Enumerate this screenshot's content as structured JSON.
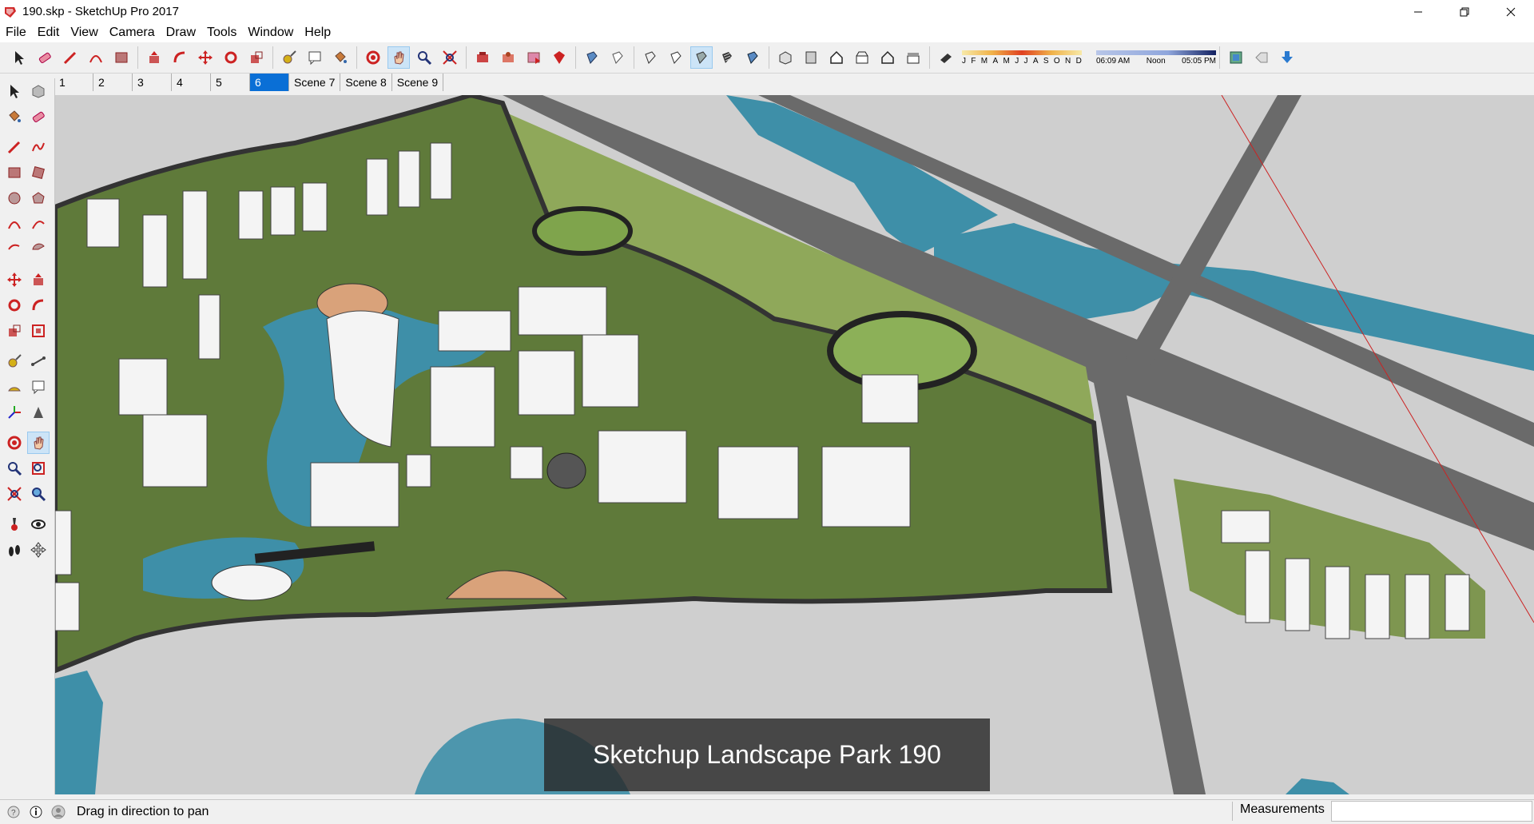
{
  "window": {
    "title": "190.skp - SketchUp Pro 2017",
    "app_icon": "sketchup-logo-icon",
    "controls": [
      "minimize-icon",
      "restore-icon",
      "close-icon"
    ]
  },
  "menu": [
    "File",
    "Edit",
    "View",
    "Camera",
    "Draw",
    "Tools",
    "Window",
    "Help"
  ],
  "toolbar": {
    "groups": [
      [
        "select-icon",
        "eraser-icon",
        "pencil-icon",
        "arc-icon",
        "rectangle-icon"
      ],
      [
        "push-pull-icon",
        "follow-me-icon",
        "move-icon",
        "rotate-icon",
        "scale-icon"
      ],
      [
        "tape-measure-icon",
        "text-icon",
        "paint-bucket-icon"
      ],
      [
        "orbit-icon",
        "pan-icon",
        "zoom-icon",
        "zoom-extents-icon"
      ],
      [
        "warehouse-icon",
        "extension-icon",
        "send-to-layout-icon",
        "ruby-icon"
      ],
      [
        "xray-icon",
        "back-edges-icon",
        "wireframe-icon",
        "hidden-line-icon",
        "shaded-icon",
        "shaded-texture-icon",
        "monochrome-icon"
      ],
      [
        "iso-view-icon",
        "top-view-icon",
        "front-view-icon",
        "right-view-icon",
        "back-view-icon",
        "left-view-icon"
      ]
    ],
    "shadow_months": [
      "J",
      "F",
      "M",
      "A",
      "M",
      "J",
      "J",
      "A",
      "S",
      "O",
      "N",
      "D"
    ],
    "time_start": "06:09 AM",
    "time_mid": "Noon",
    "time_end": "05:05 PM",
    "extra_icons": [
      "styles-icon",
      "tag-icon",
      "download-icon"
    ]
  },
  "scenes": [
    {
      "label": "1",
      "active": false
    },
    {
      "label": "2",
      "active": false
    },
    {
      "label": "3",
      "active": false
    },
    {
      "label": "4",
      "active": false
    },
    {
      "label": "5",
      "active": false
    },
    {
      "label": "6",
      "active": true
    },
    {
      "label": "Scene 7",
      "active": false
    },
    {
      "label": "Scene 8",
      "active": false
    },
    {
      "label": "Scene 9",
      "active": false
    }
  ],
  "left_tools": [
    [
      "select-icon",
      "component-icon"
    ],
    [
      "paint-bucket-icon",
      "eraser-icon"
    ],
    [
      "line-icon",
      "freehand-icon"
    ],
    [
      "rectangle-icon",
      "rotated-rectangle-icon"
    ],
    [
      "circle-icon",
      "polygon-icon"
    ],
    [
      "arc-icon",
      "two-point-arc-icon"
    ],
    [
      "three-point-arc-icon",
      "pie-icon"
    ],
    [
      "move-icon",
      "push-pull-icon"
    ],
    [
      "rotate-icon",
      "follow-me-icon"
    ],
    [
      "scale-icon",
      "offset-icon"
    ],
    [
      "tape-measure-icon",
      "dimension-icon"
    ],
    [
      "protractor-icon",
      "text-icon"
    ],
    [
      "axes-icon",
      "3d-text-icon"
    ],
    [
      "orbit-icon",
      "pan-icon"
    ],
    [
      "zoom-icon",
      "zoom-window-icon"
    ],
    [
      "zoom-extents-icon",
      "previous-view-icon"
    ],
    [
      "position-camera-icon",
      "look-around-icon"
    ],
    [
      "walk-icon",
      "section-plane-icon"
    ]
  ],
  "viewport": {
    "caption": "Sketchup Landscape Park 190",
    "colors": {
      "ground": "#cfcfcf",
      "lawn": "#8fa85a",
      "grass_dark": "#5f7a3a",
      "water": "#3e8fa8",
      "road": "#6a6a6a",
      "building": "#f4f4f4",
      "plaza": "#d9a27a"
    }
  },
  "status": {
    "hint": "Drag in direction to pan",
    "measurements_label": "Measurements",
    "measurements_value": ""
  }
}
